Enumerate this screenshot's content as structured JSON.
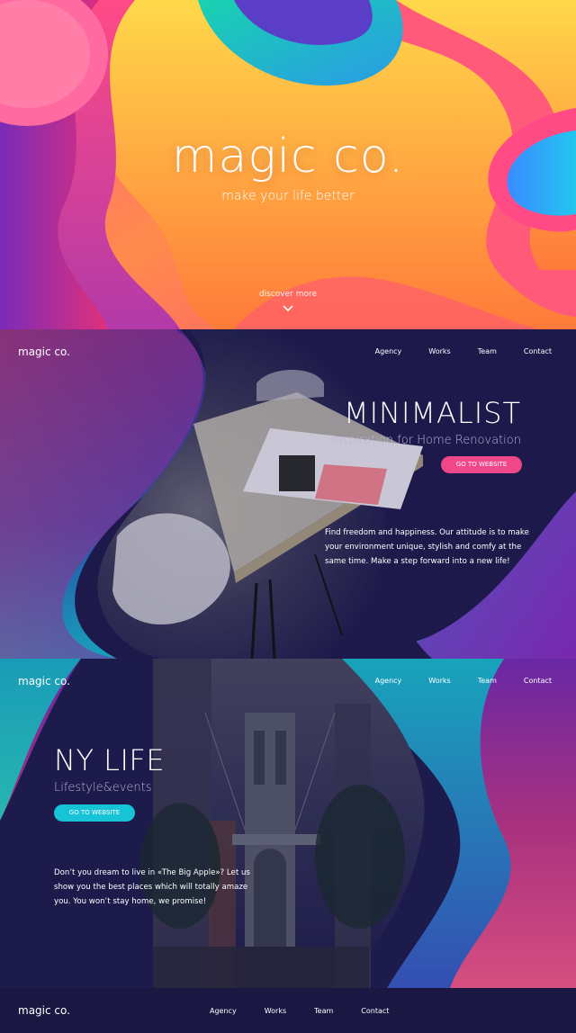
{
  "hero": {
    "title": "magic co.",
    "subtitle": "make your life better",
    "discover_label": "discover more",
    "discover_icon": "chevron-down-icon"
  },
  "nav": {
    "logo": "magic co.",
    "links": [
      "Agency",
      "Works",
      "Team",
      "Contact"
    ]
  },
  "minimalist": {
    "title": "MINIMALIST",
    "subtitle": "Inspiration for Home Renovation",
    "button_label": "GO TO WEBSITE",
    "description": "Find freedom and happiness. Our attitude is to make your environment unique, stylish and comfy at the same time. Make a step forward into a new life!",
    "button_color": "#f0468a"
  },
  "nylife": {
    "title": "NY LIFE",
    "subtitle": "Lifestyle&events",
    "button_label": "GO TO WEBSITE",
    "description": "Don’t you dream to live in «The Big Apple»? Let us show you the best places which will totally amaze you. You won’t stay home, we promise!",
    "button_color": "#17c3d6"
  },
  "footer": {
    "logo": "magic co.",
    "links": [
      "Agency",
      "Works",
      "Team",
      "Contact"
    ]
  },
  "colors": {
    "navy": "#1d1a48",
    "pink": "#f0468a",
    "cyan": "#17c3d6",
    "orange": "#ff9a3c",
    "purple": "#7a2bb8"
  }
}
